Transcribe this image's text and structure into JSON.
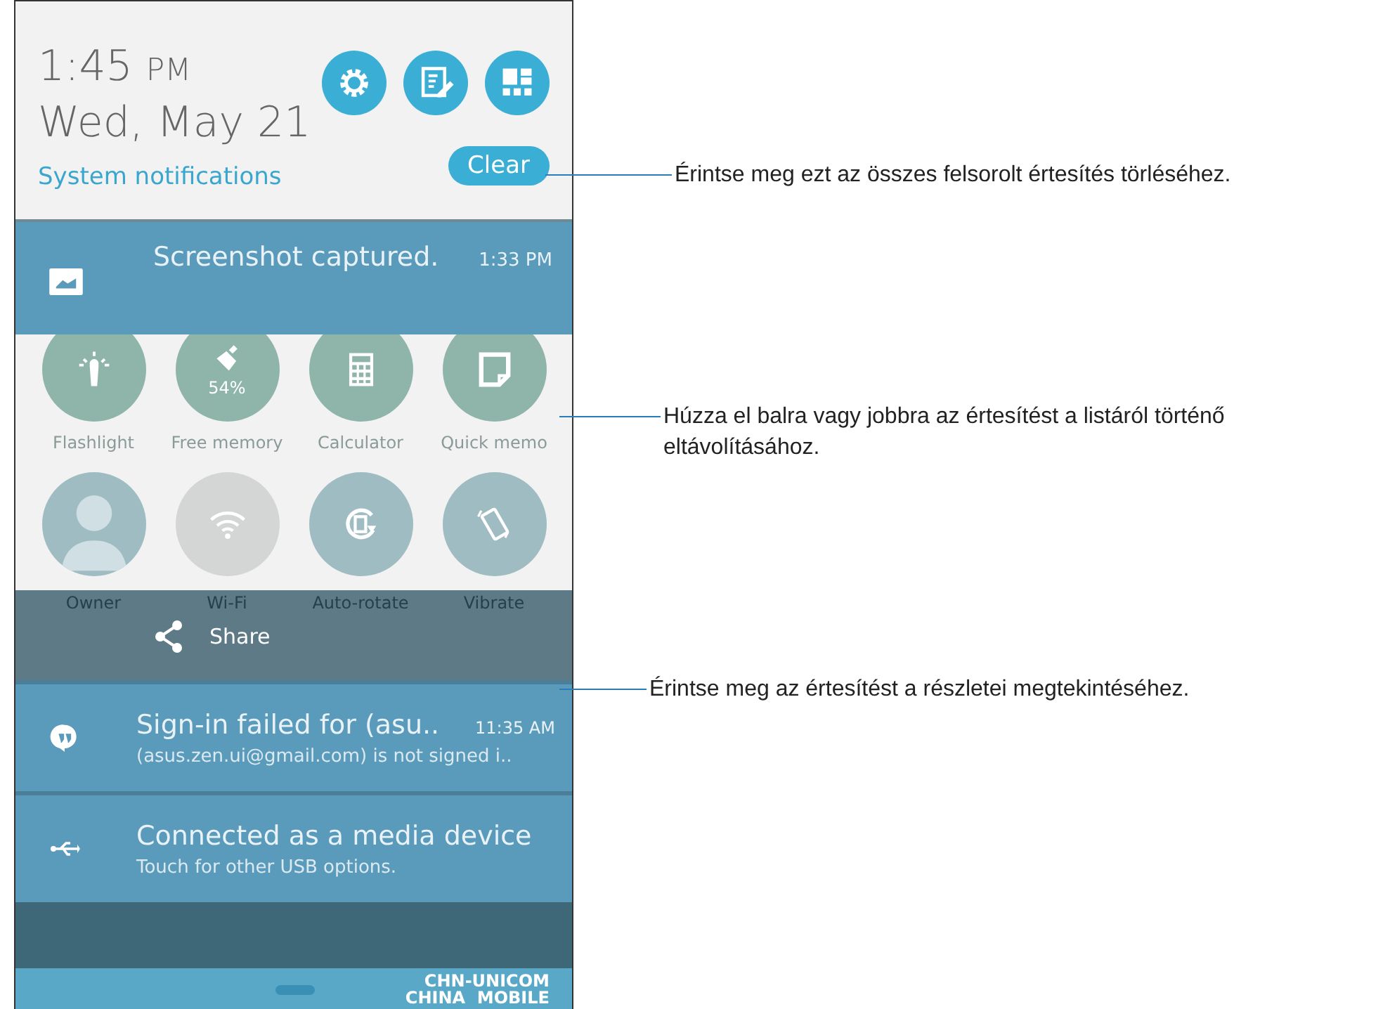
{
  "header": {
    "time": "1:45",
    "ampm": "PM",
    "date": "Wed, May 21",
    "section": "System notifications",
    "clear": "Clear"
  },
  "notifications_top": [
    {
      "title": "Screenshot captured.",
      "time": "1:33 PM"
    }
  ],
  "quick_settings": [
    {
      "label": "Flashlight",
      "on": true
    },
    {
      "label": "Free memory",
      "on": true,
      "reading": "54%"
    },
    {
      "label": "Calculator",
      "on": true
    },
    {
      "label": "Quick memo",
      "on": true
    },
    {
      "label": "Owner",
      "on": true
    },
    {
      "label": "Wi-Fi",
      "on": false
    },
    {
      "label": "Auto-rotate",
      "on": true
    },
    {
      "label": "Vibrate",
      "on": true
    }
  ],
  "share": {
    "label": "Share"
  },
  "notifications": [
    {
      "title": "Sign-in failed for (asu..",
      "time": "11:35 AM",
      "text": "(asus.zen.ui@gmail.com) is not signed i.."
    },
    {
      "title": "Connected as a media device",
      "text": "Touch for other USB options."
    }
  ],
  "carriers": [
    "CHN-UNICOM",
    "CHINA  MOBILE"
  ],
  "callouts": [
    "Érintse meg ezt az összes felsorolt értesítés törléséhez.",
    "Húzza el balra vagy jobbra az értesítést a listáról történő eltávolításához.",
    "Érintse meg az értesítést a részletei megtekintéséhez."
  ]
}
